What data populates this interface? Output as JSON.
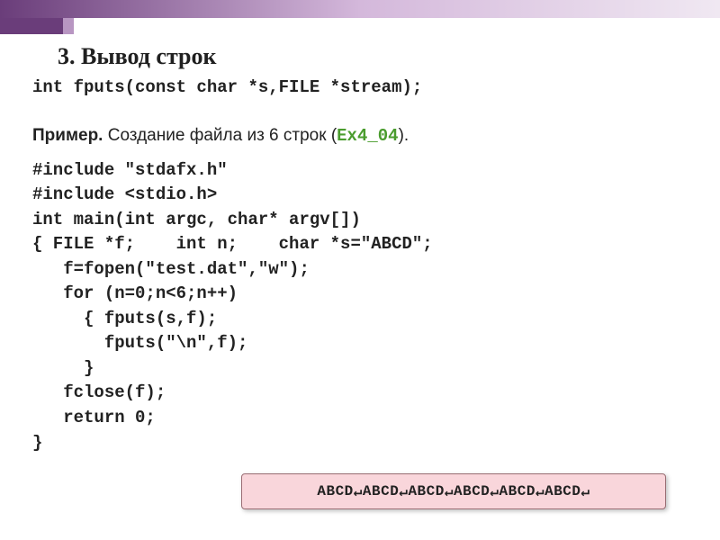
{
  "header": {
    "title": "3. Вывод строк"
  },
  "signature": "int fputs(const char *s,FILE *stream);",
  "example": {
    "label_bold": "Пример.",
    "label_rest": " Создание файла из 6 строк (",
    "ex_code": "Ex4_04",
    "label_close": ")."
  },
  "code": {
    "l1": "#include \"stdafx.h\"",
    "l2": "#include <stdio.h>",
    "l3": "int main(int argc, char* argv[])",
    "l4": "{ FILE *f;    int n;    char *s=\"ABCD\";",
    "l5": "   f=fopen(\"test.dat\",\"w\");",
    "l6": "   for (n=0;n<6;n++)",
    "l7": "     { fputs(s,f);",
    "l8": "       fputs(\"\\n\",f);",
    "l9": "     }",
    "l10": "   fclose(f);",
    "l11": "   return 0;",
    "l12": "}"
  },
  "output": {
    "token": "ABCD",
    "repeat": 6,
    "crlf_symbol": "↵"
  }
}
